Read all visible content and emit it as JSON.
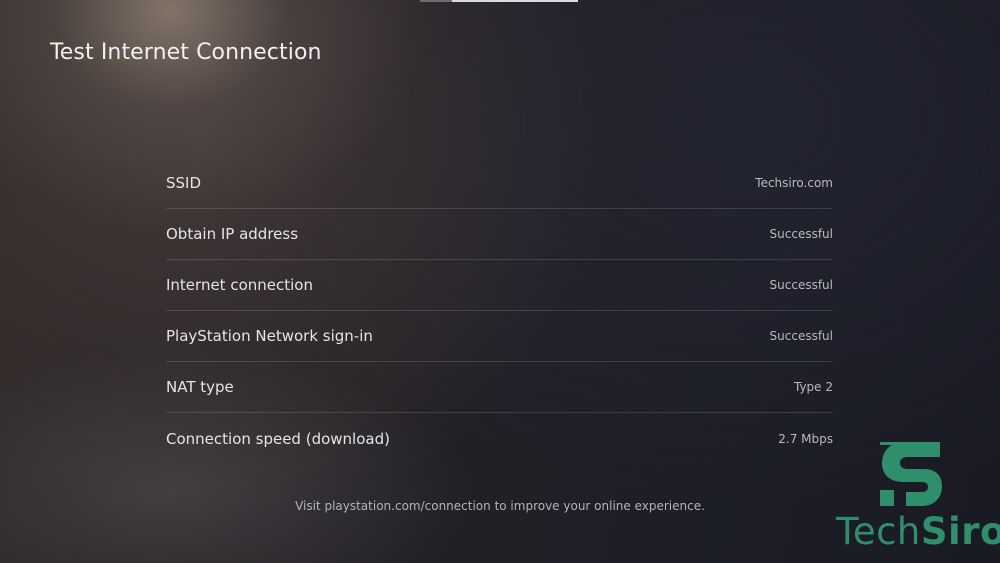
{
  "page": {
    "title": "Test Internet Connection"
  },
  "results": [
    {
      "label": "SSID",
      "value": "Techsiro.com"
    },
    {
      "label": "Obtain IP address",
      "value": "Successful"
    },
    {
      "label": "Internet connection",
      "value": "Successful"
    },
    {
      "label": "PlayStation Network sign-in",
      "value": "Successful"
    },
    {
      "label": "NAT type",
      "value": "Type 2"
    },
    {
      "label": "Connection speed (download)",
      "value": "2.7 Mbps"
    }
  ],
  "footer": {
    "note": "Visit playstation.com/connection to improve your online experience."
  },
  "watermark": {
    "brand_part1": "Tech",
    "brand_part2": "Siro",
    "icon": "techsiro-logo-icon",
    "color": "#2f8f6c"
  },
  "colors": {
    "text_primary": "#e4e4e7",
    "text_secondary": "#b9b9c0",
    "divider": "#3a3a42"
  }
}
